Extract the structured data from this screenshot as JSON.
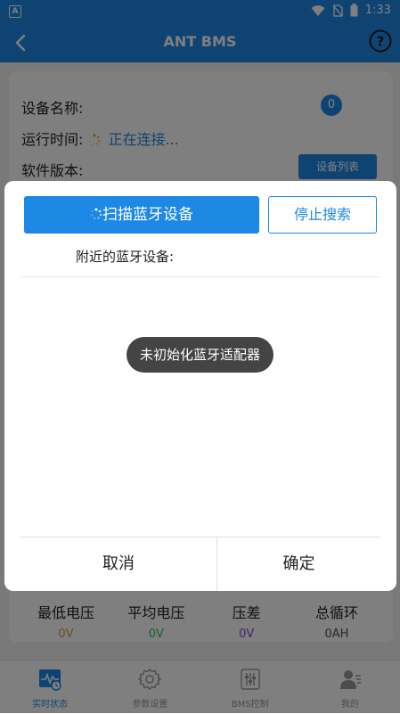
{
  "status_bar": {
    "app_icon_letter": "A",
    "time": "1:33"
  },
  "app_bar": {
    "title": "ANT BMS"
  },
  "device_info": {
    "name_label": "设备名称:",
    "device_count": "0",
    "runtime_label": "运行时间:",
    "connecting_text": "正在连接...",
    "software_label": "软件版本:",
    "device_list_button": "设备列表"
  },
  "stats": [
    {
      "label": "最低电压",
      "value": "0V",
      "color": "#e09a3a"
    },
    {
      "label": "平均电压",
      "value": "0V",
      "color": "#2ec24a"
    },
    {
      "label": "压差",
      "value": "0V",
      "color": "#7d4bd6"
    },
    {
      "label": "总循环",
      "value": "0AH",
      "color": "#555555"
    }
  ],
  "dialog": {
    "scan_button": "扫描蓝牙设备",
    "stop_button": "停止搜索",
    "nearby_label": "附近的蓝牙设备:",
    "toast": "未初始化蓝牙适配器",
    "cancel_button": "取消",
    "confirm_button": "确定"
  },
  "bottom_nav": [
    {
      "label": "实时状态",
      "icon": "realtime-status-icon",
      "active": true
    },
    {
      "label": "参数设置",
      "icon": "gear-icon",
      "active": false
    },
    {
      "label": "BMS控制",
      "icon": "sliders-icon",
      "active": false
    },
    {
      "label": "我的",
      "icon": "user-icon",
      "active": false
    }
  ],
  "colors": {
    "primary": "#1e88e5"
  }
}
